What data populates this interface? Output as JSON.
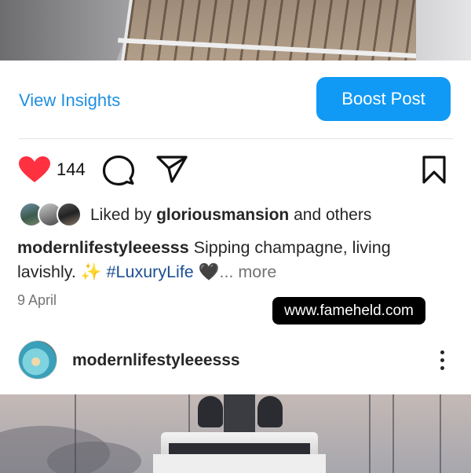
{
  "post": {
    "view_insights_label": "View Insights",
    "boost_label": "Boost Post",
    "like_count": "144",
    "liked_by_prefix": "Liked by ",
    "liked_by_user": "gloriousmansion",
    "liked_by_suffix": " and others",
    "caption_user": "modernlifestyleeesss",
    "caption_text": " Sipping champagne, living lavishly. ✨ ",
    "caption_hashtag": "#LuxuryLife",
    "caption_emoji": " 🖤",
    "caption_more": "... more",
    "date": "9 April"
  },
  "watermark": "www.fameheld.com",
  "next_post": {
    "username": "modernlifestyleeesss"
  },
  "colors": {
    "accent": "#1f8fe0",
    "boost_button": "#119af5",
    "heart": "#ff3040",
    "hashtag": "#1b4f93"
  },
  "icons": [
    "heart-icon",
    "comment-icon",
    "share-icon",
    "bookmark-icon",
    "more-options-icon"
  ]
}
